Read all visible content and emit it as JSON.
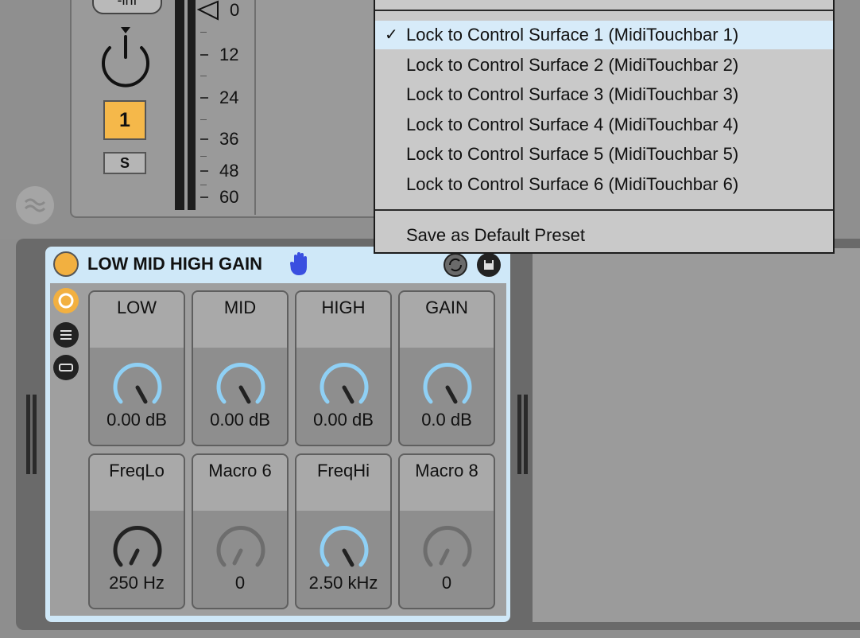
{
  "track": {
    "volume_label": "-inf",
    "number_label": "1",
    "solo_label": "S",
    "meter_scale": [
      "0",
      "12",
      "24",
      "36",
      "48",
      "60"
    ]
  },
  "context_menu": {
    "items": [
      {
        "label": "Lock to Control Surface 1 (MidiTouchbar 1)",
        "checked": true
      },
      {
        "label": "Lock to Control Surface 2 (MidiTouchbar 2)",
        "checked": false
      },
      {
        "label": "Lock to Control Surface 3 (MidiTouchbar 3)",
        "checked": false
      },
      {
        "label": "Lock to Control Surface 4 (MidiTouchbar 4)",
        "checked": false
      },
      {
        "label": "Lock to Control Surface 5 (MidiTouchbar 5)",
        "checked": false
      },
      {
        "label": "Lock to Control Surface 6 (MidiTouchbar 6)",
        "checked": false
      }
    ],
    "check_mark": "✓",
    "save_default_label": "Save as Default Preset"
  },
  "rack": {
    "title": "LOW MID HIGH GAIN",
    "colors": {
      "accent": "#f2b040",
      "knob_active": "#8fd0f5",
      "rack_border": "#cfe8f8"
    },
    "macros": [
      {
        "name": "LOW",
        "value": "0.00 dB",
        "active": true,
        "mapped": true
      },
      {
        "name": "MID",
        "value": "0.00 dB",
        "active": true,
        "mapped": true
      },
      {
        "name": "HIGH",
        "value": "0.00 dB",
        "active": true,
        "mapped": true
      },
      {
        "name": "GAIN",
        "value": "0.0 dB",
        "active": true,
        "mapped": true
      },
      {
        "name": "FreqLo",
        "value": "250 Hz",
        "active": false,
        "mapped": true
      },
      {
        "name": "Macro 6",
        "value": "0",
        "active": false,
        "mapped": false
      },
      {
        "name": "FreqHi",
        "value": "2.50 kHz",
        "active": true,
        "mapped": true
      },
      {
        "name": "Macro 8",
        "value": "0",
        "active": false,
        "mapped": false
      }
    ]
  }
}
